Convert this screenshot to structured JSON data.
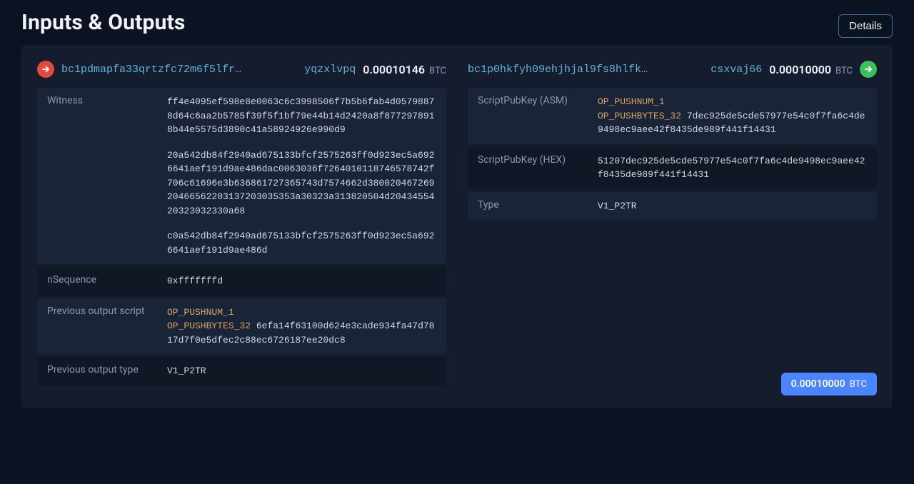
{
  "header": {
    "title": "Inputs & Outputs",
    "details_button": "Details"
  },
  "input": {
    "arrow_icon": "arrow-right",
    "address_prefix": "bc1pdmapfa33qrtzfc72m6f5lfr…",
    "address_suffix": "yqzxlvpq",
    "amount": "0.00010146",
    "unit": "BTC",
    "fields": {
      "witness_label": "Witness",
      "witness_blocks": [
        "ff4e4095ef598e8e0063c6c3998506f7b5b6fab4d05798878d64c6aa2b5785f39f5f1bf79e44b14d2420a8f8772978918b44e5575d3890c41a58924926e990d9",
        "20a542db84f2940ad675133bfcf2575263ff0d923ec5a6926641aef191d9ae486dac0063036f7264010118746578742f706c61696e3b636861727365743d7574662d38002046726920466562203137203035353a30323a313820504d2043455420323032330a68",
        "c0a542db84f2940ad675133bfcf2575263ff0d923ec5a6926641aef191d9ae486d"
      ],
      "nsequence_label": "nSequence",
      "nsequence_value": "0xfffffffd",
      "prev_script_label": "Previous output script",
      "prev_script_op1": "OP_PUSHNUM_1",
      "prev_script_op2": "OP_PUSHBYTES_32",
      "prev_script_hex": "6efa14f63100d624e3cade934fa47d7817d7f0e5dfec2c88ec6726187ee20dc8",
      "prev_type_label": "Previous output type",
      "prev_type_value": "V1_P2TR"
    }
  },
  "output": {
    "arrow_icon": "arrow-right",
    "address_prefix": "bc1p0hkfyh09ehjhjal9fs8hlfk…",
    "address_suffix": "csxvaj66",
    "amount": "0.00010000",
    "unit": "BTC",
    "fields": {
      "spk_asm_label": "ScriptPubKey (ASM)",
      "spk_asm_op1": "OP_PUSHNUM_1",
      "spk_asm_op2": "OP_PUSHBYTES_32",
      "spk_asm_hex": "7dec925de5cde57977e54c0f7fa6c4de9498ec9aee42f8435de989f441f14431",
      "spk_hex_label": "ScriptPubKey (HEX)",
      "spk_hex_value": "51207dec925de5cde57977e54c0f7fa6c4de9498ec9aee42f8435de989f441f14431",
      "type_label": "Type",
      "type_value": "V1_P2TR"
    }
  },
  "total": {
    "amount": "0.00010000",
    "unit": "BTC"
  }
}
